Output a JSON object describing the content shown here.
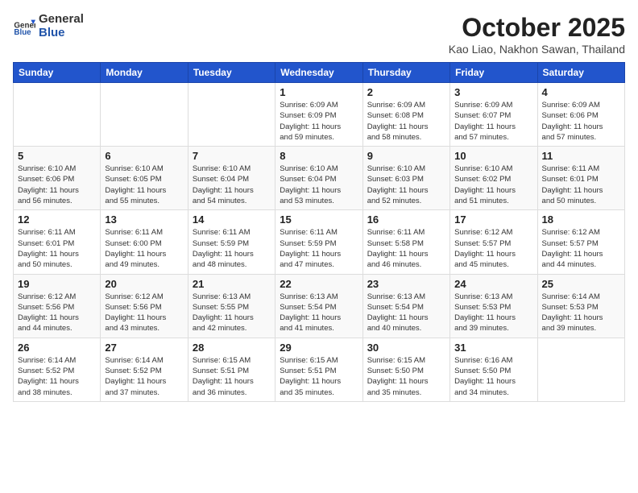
{
  "header": {
    "logo_general": "General",
    "logo_blue": "Blue",
    "month": "October 2025",
    "location": "Kao Liao, Nakhon Sawan, Thailand"
  },
  "days_of_week": [
    "Sunday",
    "Monday",
    "Tuesday",
    "Wednesday",
    "Thursday",
    "Friday",
    "Saturday"
  ],
  "weeks": [
    [
      {
        "day": "",
        "info": ""
      },
      {
        "day": "",
        "info": ""
      },
      {
        "day": "",
        "info": ""
      },
      {
        "day": "1",
        "info": "Sunrise: 6:09 AM\nSunset: 6:09 PM\nDaylight: 11 hours\nand 59 minutes."
      },
      {
        "day": "2",
        "info": "Sunrise: 6:09 AM\nSunset: 6:08 PM\nDaylight: 11 hours\nand 58 minutes."
      },
      {
        "day": "3",
        "info": "Sunrise: 6:09 AM\nSunset: 6:07 PM\nDaylight: 11 hours\nand 57 minutes."
      },
      {
        "day": "4",
        "info": "Sunrise: 6:09 AM\nSunset: 6:06 PM\nDaylight: 11 hours\nand 57 minutes."
      }
    ],
    [
      {
        "day": "5",
        "info": "Sunrise: 6:10 AM\nSunset: 6:06 PM\nDaylight: 11 hours\nand 56 minutes."
      },
      {
        "day": "6",
        "info": "Sunrise: 6:10 AM\nSunset: 6:05 PM\nDaylight: 11 hours\nand 55 minutes."
      },
      {
        "day": "7",
        "info": "Sunrise: 6:10 AM\nSunset: 6:04 PM\nDaylight: 11 hours\nand 54 minutes."
      },
      {
        "day": "8",
        "info": "Sunrise: 6:10 AM\nSunset: 6:04 PM\nDaylight: 11 hours\nand 53 minutes."
      },
      {
        "day": "9",
        "info": "Sunrise: 6:10 AM\nSunset: 6:03 PM\nDaylight: 11 hours\nand 52 minutes."
      },
      {
        "day": "10",
        "info": "Sunrise: 6:10 AM\nSunset: 6:02 PM\nDaylight: 11 hours\nand 51 minutes."
      },
      {
        "day": "11",
        "info": "Sunrise: 6:11 AM\nSunset: 6:01 PM\nDaylight: 11 hours\nand 50 minutes."
      }
    ],
    [
      {
        "day": "12",
        "info": "Sunrise: 6:11 AM\nSunset: 6:01 PM\nDaylight: 11 hours\nand 50 minutes."
      },
      {
        "day": "13",
        "info": "Sunrise: 6:11 AM\nSunset: 6:00 PM\nDaylight: 11 hours\nand 49 minutes."
      },
      {
        "day": "14",
        "info": "Sunrise: 6:11 AM\nSunset: 5:59 PM\nDaylight: 11 hours\nand 48 minutes."
      },
      {
        "day": "15",
        "info": "Sunrise: 6:11 AM\nSunset: 5:59 PM\nDaylight: 11 hours\nand 47 minutes."
      },
      {
        "day": "16",
        "info": "Sunrise: 6:11 AM\nSunset: 5:58 PM\nDaylight: 11 hours\nand 46 minutes."
      },
      {
        "day": "17",
        "info": "Sunrise: 6:12 AM\nSunset: 5:57 PM\nDaylight: 11 hours\nand 45 minutes."
      },
      {
        "day": "18",
        "info": "Sunrise: 6:12 AM\nSunset: 5:57 PM\nDaylight: 11 hours\nand 44 minutes."
      }
    ],
    [
      {
        "day": "19",
        "info": "Sunrise: 6:12 AM\nSunset: 5:56 PM\nDaylight: 11 hours\nand 44 minutes."
      },
      {
        "day": "20",
        "info": "Sunrise: 6:12 AM\nSunset: 5:56 PM\nDaylight: 11 hours\nand 43 minutes."
      },
      {
        "day": "21",
        "info": "Sunrise: 6:13 AM\nSunset: 5:55 PM\nDaylight: 11 hours\nand 42 minutes."
      },
      {
        "day": "22",
        "info": "Sunrise: 6:13 AM\nSunset: 5:54 PM\nDaylight: 11 hours\nand 41 minutes."
      },
      {
        "day": "23",
        "info": "Sunrise: 6:13 AM\nSunset: 5:54 PM\nDaylight: 11 hours\nand 40 minutes."
      },
      {
        "day": "24",
        "info": "Sunrise: 6:13 AM\nSunset: 5:53 PM\nDaylight: 11 hours\nand 39 minutes."
      },
      {
        "day": "25",
        "info": "Sunrise: 6:14 AM\nSunset: 5:53 PM\nDaylight: 11 hours\nand 39 minutes."
      }
    ],
    [
      {
        "day": "26",
        "info": "Sunrise: 6:14 AM\nSunset: 5:52 PM\nDaylight: 11 hours\nand 38 minutes."
      },
      {
        "day": "27",
        "info": "Sunrise: 6:14 AM\nSunset: 5:52 PM\nDaylight: 11 hours\nand 37 minutes."
      },
      {
        "day": "28",
        "info": "Sunrise: 6:15 AM\nSunset: 5:51 PM\nDaylight: 11 hours\nand 36 minutes."
      },
      {
        "day": "29",
        "info": "Sunrise: 6:15 AM\nSunset: 5:51 PM\nDaylight: 11 hours\nand 35 minutes."
      },
      {
        "day": "30",
        "info": "Sunrise: 6:15 AM\nSunset: 5:50 PM\nDaylight: 11 hours\nand 35 minutes."
      },
      {
        "day": "31",
        "info": "Sunrise: 6:16 AM\nSunset: 5:50 PM\nDaylight: 11 hours\nand 34 minutes."
      },
      {
        "day": "",
        "info": ""
      }
    ]
  ]
}
